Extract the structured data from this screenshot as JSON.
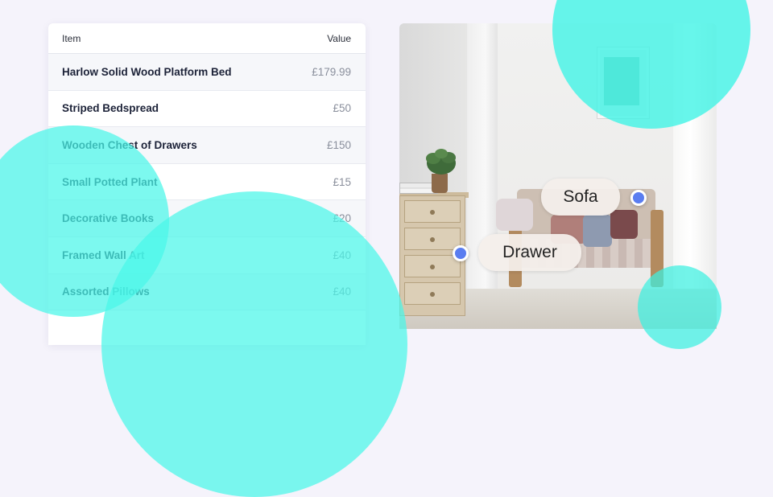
{
  "table": {
    "columns": {
      "item": "Item",
      "value": "Value"
    },
    "rows": [
      {
        "item": "Harlow Solid Wood Platform Bed",
        "value": "£179.99"
      },
      {
        "item": "Striped Bedspread",
        "value": "£50"
      },
      {
        "item": "Wooden Chest of Drawers",
        "value": "£150"
      },
      {
        "item": "Small Potted Plant",
        "value": "£15"
      },
      {
        "item": "Decorative Books",
        "value": "£20"
      },
      {
        "item": "Framed Wall Art",
        "value": "£40"
      },
      {
        "item": "Assorted Pillows",
        "value": "£40"
      }
    ]
  },
  "hotspots": {
    "sofa": {
      "label": "Sofa"
    },
    "drawer": {
      "label": "Drawer"
    }
  },
  "colors": {
    "accent_teal": "#3cf4e6",
    "hotspot_dot": "#5a7df0",
    "text_dark": "#1c2238",
    "text_muted": "#8a8f9c"
  }
}
